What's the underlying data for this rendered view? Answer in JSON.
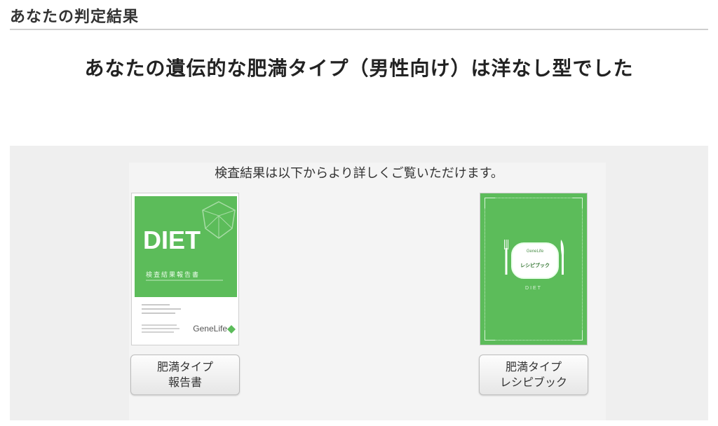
{
  "section": {
    "title": "あなたの判定結果"
  },
  "result": {
    "headline": "あなたの遺伝的な肥満タイプ（男性向け）は洋なし型でした"
  },
  "detail": {
    "intro": "検査結果は以下からより詳しくご覧いただけます。"
  },
  "books": [
    {
      "cover": {
        "diet": "DIET",
        "subtitle": "検査結果報告書",
        "brand": "GeneLife",
        "color": "#5cbc5a"
      },
      "button": {
        "line1": "肥満タイプ",
        "line2": "報告書"
      }
    },
    {
      "cover": {
        "brand": "GeneLife",
        "title": "レシピブック",
        "diet": "DIET",
        "color": "#5cbc5a"
      },
      "button": {
        "line1": "肥満タイプ",
        "line2": "レシピブック"
      }
    }
  ]
}
